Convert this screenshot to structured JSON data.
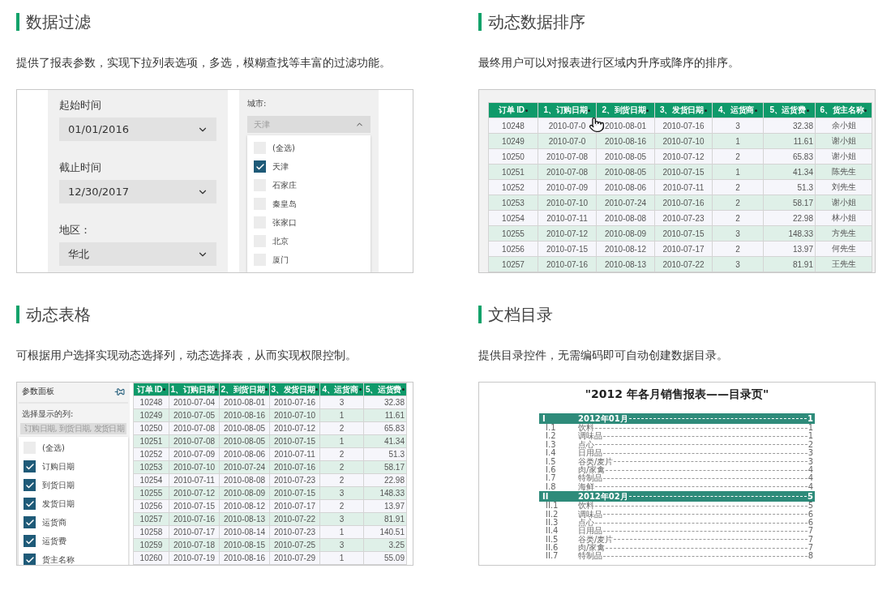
{
  "sections": [
    {
      "kind": "filter",
      "title": "数据过滤",
      "description": "提供了报表参数，实现下拉列表选项，多选，模糊查找等丰富的过滤功能。",
      "fields": [
        {
          "label": "起始时间",
          "value": "01/01/2016"
        },
        {
          "label": "截止时间",
          "value": "12/30/2017"
        },
        {
          "label": "地区：",
          "value": "华北"
        }
      ],
      "city": {
        "label": "城市:",
        "value": "天津",
        "options": [
          {
            "label": "(全选)",
            "checked": false
          },
          {
            "label": "天津",
            "checked": true
          },
          {
            "label": "石家庄",
            "checked": false
          },
          {
            "label": "秦皇岛",
            "checked": false
          },
          {
            "label": "张家口",
            "checked": false
          },
          {
            "label": "北京",
            "checked": false
          },
          {
            "label": "厦门",
            "checked": false
          }
        ]
      }
    },
    {
      "kind": "sort_table",
      "title": "动态数据排序",
      "description": "最终用户可以对报表进行区域内升序或降序的排序。",
      "table": {
        "columns": [
          {
            "label": "订单 ID",
            "kind": "text"
          },
          {
            "label": "1、订购日期",
            "kind": "text"
          },
          {
            "label": "2、到货日期",
            "kind": "text"
          },
          {
            "label": "3、发货日期",
            "kind": "text"
          },
          {
            "label": "4、运货商",
            "kind": "text"
          },
          {
            "label": "5、运货费",
            "kind": "number"
          },
          {
            "label": "6、货主名称",
            "kind": "text"
          }
        ],
        "rows": [
          [
            "10248",
            "2010-07-0",
            "2010-08-01",
            "2010-07-16",
            "3",
            "32.38",
            "余小姐"
          ],
          [
            "10249",
            "2010-07-0",
            "2010-08-16",
            "2010-07-10",
            "1",
            "11.61",
            "谢小姐"
          ],
          [
            "10250",
            "2010-07-08",
            "2010-08-05",
            "2010-07-12",
            "2",
            "65.83",
            "谢小姐"
          ],
          [
            "10251",
            "2010-07-08",
            "2010-08-05",
            "2010-07-15",
            "1",
            "41.34",
            "陈先生"
          ],
          [
            "10252",
            "2010-07-09",
            "2010-08-06",
            "2010-07-11",
            "2",
            "51.3",
            "刘先生"
          ],
          [
            "10253",
            "2010-07-10",
            "2010-07-24",
            "2010-07-16",
            "2",
            "58.17",
            "谢小姐"
          ],
          [
            "10254",
            "2010-07-11",
            "2010-08-08",
            "2010-07-23",
            "2",
            "22.98",
            "林小姐"
          ],
          [
            "10255",
            "2010-07-12",
            "2010-08-09",
            "2010-07-15",
            "3",
            "148.33",
            "方先生"
          ],
          [
            "10256",
            "2010-07-15",
            "2010-08-12",
            "2010-07-17",
            "2",
            "13.97",
            "何先生"
          ],
          [
            "10257",
            "2010-07-16",
            "2010-08-13",
            "2010-07-22",
            "3",
            "81.91",
            "王先生"
          ]
        ]
      }
    },
    {
      "kind": "dynamic_table",
      "title": "动态表格",
      "description": "可根据用户选择实现动态选择列，动态选择表，从而实现权限控制。",
      "panel": {
        "title": "参数面板",
        "label": "选择显示的列:",
        "value": "订购日期, 到货日期, 发货日期",
        "options": [
          {
            "label": "(全选)",
            "checked": false
          },
          {
            "label": "订购日期",
            "checked": true
          },
          {
            "label": "到货日期",
            "checked": true
          },
          {
            "label": "发货日期",
            "checked": true
          },
          {
            "label": "运货商",
            "checked": true
          },
          {
            "label": "运货费",
            "checked": true
          },
          {
            "label": "货主名称",
            "checked": true
          }
        ]
      },
      "table": {
        "columns": [
          {
            "label": "订单 ID",
            "kind": "text"
          },
          {
            "label": "1、订购日期",
            "kind": "text"
          },
          {
            "label": "2、到货日期",
            "kind": "text"
          },
          {
            "label": "3、发货日期",
            "kind": "text"
          },
          {
            "label": "4、运货商",
            "kind": "text"
          },
          {
            "label": "5、运货费",
            "kind": "number"
          }
        ],
        "rows": [
          [
            "10248",
            "2010-07-04",
            "2010-08-01",
            "2010-07-16",
            "3",
            "32.38"
          ],
          [
            "10249",
            "2010-07-05",
            "2010-08-16",
            "2010-07-10",
            "1",
            "11.61"
          ],
          [
            "10250",
            "2010-07-08",
            "2010-08-05",
            "2010-07-12",
            "2",
            "65.83"
          ],
          [
            "10251",
            "2010-07-08",
            "2010-08-05",
            "2010-07-15",
            "1",
            "41.34"
          ],
          [
            "10252",
            "2010-07-09",
            "2010-08-06",
            "2010-07-11",
            "2",
            "51.3"
          ],
          [
            "10253",
            "2010-07-10",
            "2010-07-24",
            "2010-07-16",
            "2",
            "58.17"
          ],
          [
            "10254",
            "2010-07-11",
            "2010-08-08",
            "2010-07-23",
            "2",
            "22.98"
          ],
          [
            "10255",
            "2010-07-12",
            "2010-08-09",
            "2010-07-15",
            "3",
            "148.33"
          ],
          [
            "10256",
            "2010-07-15",
            "2010-08-12",
            "2010-07-17",
            "2",
            "13.97"
          ],
          [
            "10257",
            "2010-07-16",
            "2010-08-13",
            "2010-07-22",
            "3",
            "81.91"
          ],
          [
            "10258",
            "2010-07-17",
            "2010-08-14",
            "2010-07-23",
            "1",
            "140.51"
          ],
          [
            "10259",
            "2010-07-18",
            "2010-08-15",
            "2010-07-25",
            "3",
            "3.25"
          ],
          [
            "10260",
            "2010-07-19",
            "2010-08-16",
            "2010-07-29",
            "1",
            "55.09"
          ]
        ]
      }
    },
    {
      "kind": "toc",
      "title": "文档目录",
      "description": "提供目录控件，无需编码即可自动创建数据目录。",
      "toc": {
        "title": "\"2012 年各月销售报表——目录页\"",
        "groups": [
          {
            "number": "I",
            "label": "2012年01月",
            "page": "1",
            "items": [
              {
                "number": "I.1",
                "label": "饮料",
                "page": "1"
              },
              {
                "number": "I.2",
                "label": "调味品",
                "page": "1"
              },
              {
                "number": "I.3",
                "label": "点心",
                "page": "2"
              },
              {
                "number": "I.4",
                "label": "日用品",
                "page": "3"
              },
              {
                "number": "I.5",
                "label": "谷类/麦片",
                "page": "3"
              },
              {
                "number": "I.6",
                "label": "肉/家禽",
                "page": "4"
              },
              {
                "number": "I.7",
                "label": "特制品",
                "page": "4"
              },
              {
                "number": "I.8",
                "label": "海鲜",
                "page": "4"
              }
            ]
          },
          {
            "number": "II",
            "label": "2012年02月",
            "page": "5",
            "items": [
              {
                "number": "II.1",
                "label": "饮料",
                "page": "5"
              },
              {
                "number": "II.2",
                "label": "调味品",
                "page": "6"
              },
              {
                "number": "II.3",
                "label": "点心",
                "page": "6"
              },
              {
                "number": "II.4",
                "label": "日用品",
                "page": "7"
              },
              {
                "number": "II.5",
                "label": "谷类/麦片",
                "page": "7"
              },
              {
                "number": "II.6",
                "label": "肉/家禽",
                "page": "7"
              },
              {
                "number": "II.7",
                "label": "特制品",
                "page": "8"
              }
            ]
          }
        ]
      }
    }
  ]
}
